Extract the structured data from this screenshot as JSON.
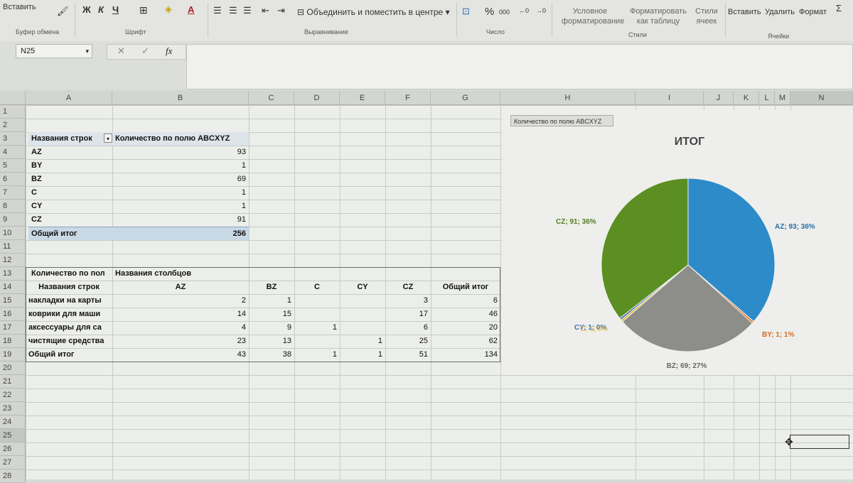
{
  "ribbon": {
    "paste": "Вставить",
    "clipboard_group": "Буфер обмена",
    "font_group": "Шрифт",
    "bold": "Ж",
    "italic": "К",
    "underline": "Ч",
    "font_color_letter": "A",
    "merge_center": "Объединить и поместить в центре",
    "alignment_group": "Выравнивание",
    "percent": "%",
    "thousands": "000",
    "number_group": "Число",
    "cond_format_1": "Условное",
    "cond_format_2": "форматирование",
    "format_table_1": "Форматировать",
    "format_table_2": "как таблицу",
    "styles_1": "Стили",
    "styles_2": "ячеек",
    "styles_group": "Стили",
    "insert": "Вставить",
    "delete": "Удалить",
    "format": "Формат",
    "cells_group": "Ячейки"
  },
  "formula_bar": {
    "name_box": "N25",
    "fx": "fx",
    "cancel": "✕",
    "confirm": "✓",
    "formula": ""
  },
  "columns": [
    "A",
    "B",
    "C",
    "D",
    "E",
    "F",
    "G",
    "H",
    "I",
    "J",
    "K",
    "L",
    "M",
    "N"
  ],
  "rows": [
    "1",
    "2",
    "3",
    "4",
    "5",
    "6",
    "7",
    "8",
    "9",
    "10",
    "11",
    "12",
    "13",
    "14",
    "15",
    "16",
    "17",
    "18",
    "19",
    "20",
    "21",
    "22",
    "23",
    "24",
    "25",
    "26",
    "27",
    "28"
  ],
  "pivot1": {
    "header_rows": "Названия строк",
    "header_values": "Количество по полю ABCXYZ",
    "rows": [
      {
        "label": "AZ",
        "value": "93"
      },
      {
        "label": "BY",
        "value": "1"
      },
      {
        "label": "BZ",
        "value": "69"
      },
      {
        "label": "C",
        "value": "1"
      },
      {
        "label": "CY",
        "value": "1"
      },
      {
        "label": "CZ",
        "value": "91"
      }
    ],
    "total_label": "Общий итог",
    "total_value": "256"
  },
  "pivot2": {
    "corner": "Количество по пол",
    "col_header": "Названия столбцов",
    "row_header": "Названия строк",
    "columns": [
      "AZ",
      "BZ",
      "C",
      "CY",
      "CZ",
      "Общий итог"
    ],
    "rows": [
      {
        "label": "накладки на карты",
        "cells": [
          "2",
          "1",
          "",
          "",
          "3",
          "6"
        ]
      },
      {
        "label": "коврики для маши",
        "cells": [
          "14",
          "15",
          "",
          "",
          "17",
          "46"
        ]
      },
      {
        "label": "аксессуары для са",
        "cells": [
          "4",
          "9",
          "1",
          "",
          "6",
          "20"
        ]
      },
      {
        "label": "чистящие средства",
        "cells": [
          "23",
          "13",
          "",
          "1",
          "25",
          "62"
        ]
      }
    ],
    "total_label": "Общий итог",
    "total_cells": [
      "43",
      "38",
      "1",
      "1",
      "51",
      "134"
    ]
  },
  "chart": {
    "field_button": "Количество по полю ABCXYZ"
  },
  "chart_data": {
    "type": "pie",
    "title": "ИТОГ",
    "categories": [
      "AZ",
      "BY",
      "BZ",
      "C",
      "CY",
      "CZ"
    ],
    "values": [
      93,
      1,
      69,
      1,
      1,
      91
    ],
    "labels": [
      "AZ; 93; 36%",
      "BY; 1; 1%",
      "BZ; 69; 27%",
      "C; 1; 0%",
      "CY; 1; 0%",
      "CZ; 91; 36%"
    ],
    "colors": [
      "#2d8bc9",
      "#e0782a",
      "#8d8d89",
      "#e8b52e",
      "#3a6fb5",
      "#5b8f22"
    ]
  }
}
